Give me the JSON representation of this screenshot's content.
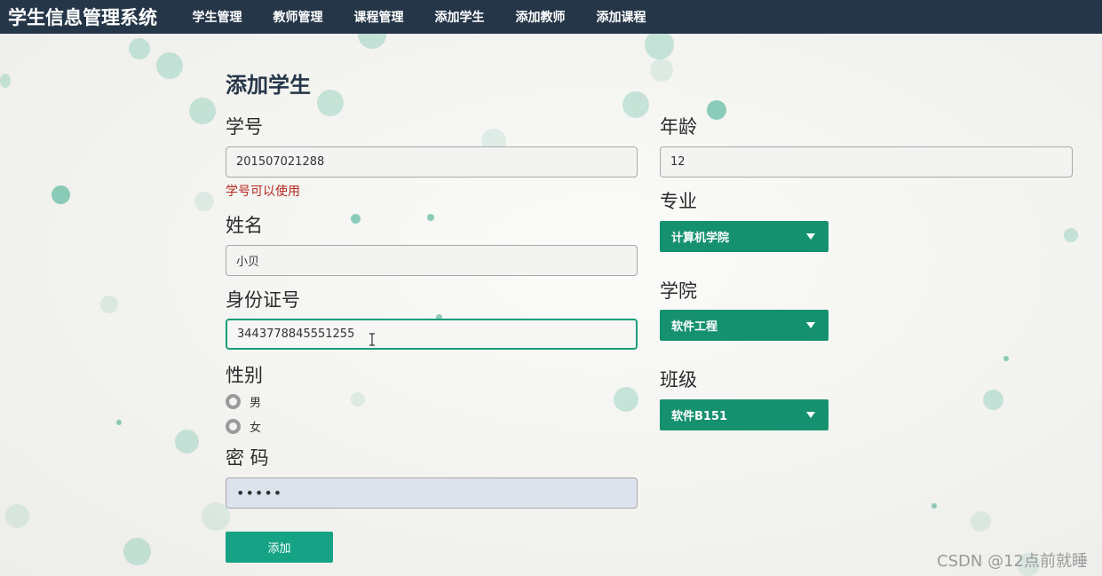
{
  "nav": {
    "brand": "学生信息管理系统",
    "items": [
      "学生管理",
      "教师管理",
      "课程管理",
      "添加学生",
      "添加教师",
      "添加课程"
    ]
  },
  "form": {
    "title": "添加学生",
    "student_id": {
      "label": "学号",
      "value": "201507021288",
      "hint": "学号可以使用"
    },
    "name": {
      "label": "姓名",
      "value": "小贝"
    },
    "id_card": {
      "label": "身份证号",
      "value": "3443778845551255"
    },
    "gender": {
      "label": "性别",
      "options": [
        "男",
        "女"
      ]
    },
    "password": {
      "label": "密 码",
      "value": "•••••"
    },
    "age": {
      "label": "年龄",
      "value": "12"
    },
    "major": {
      "label": "专业",
      "selected": "计算机学院"
    },
    "college": {
      "label": "学院",
      "selected": "软件工程"
    },
    "class": {
      "label": "班级",
      "selected": "软件B151"
    },
    "submit_label": "添加"
  },
  "watermark": "CSDN @12点前就睡",
  "colors": {
    "navbar": "#253648",
    "accent": "#16916f",
    "submit": "#16a385",
    "hint": "#b5281c"
  }
}
